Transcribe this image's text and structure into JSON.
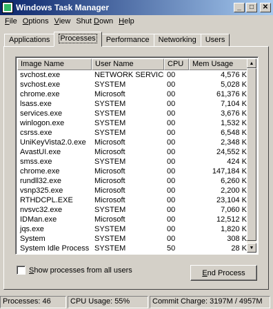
{
  "window": {
    "title": "Windows Task Manager"
  },
  "menu": [
    {
      "underline": "F",
      "rest": "ile"
    },
    {
      "underline": "O",
      "rest": "ptions"
    },
    {
      "underline": "V",
      "rest": "iew"
    },
    {
      "pre": "Shut ",
      "underline": "D",
      "rest": "own"
    },
    {
      "underline": "H",
      "rest": "elp"
    }
  ],
  "tabs": [
    "Applications",
    "Processes",
    "Performance",
    "Networking",
    "Users"
  ],
  "active_tab": "Processes",
  "columns": [
    "Image Name",
    "User Name",
    "CPU",
    "Mem Usage"
  ],
  "processes": [
    [
      "svchost.exe",
      "NETWORK SERVICE",
      "00",
      "4,576 K"
    ],
    [
      "svchost.exe",
      "SYSTEM",
      "00",
      "5,028 K"
    ],
    [
      "chrome.exe",
      "Microsoft",
      "00",
      "61,376 K"
    ],
    [
      "lsass.exe",
      "SYSTEM",
      "00",
      "7,104 K"
    ],
    [
      "services.exe",
      "SYSTEM",
      "00",
      "3,676 K"
    ],
    [
      "winlogon.exe",
      "SYSTEM",
      "00",
      "1,532 K"
    ],
    [
      "csrss.exe",
      "SYSTEM",
      "00",
      "6,548 K"
    ],
    [
      "UniKeyVista2.0.exe",
      "Microsoft",
      "00",
      "2,348 K"
    ],
    [
      "AvastUI.exe",
      "Microsoft",
      "00",
      "24,552 K"
    ],
    [
      "smss.exe",
      "SYSTEM",
      "00",
      "424 K"
    ],
    [
      "chrome.exe",
      "Microsoft",
      "00",
      "147,184 K"
    ],
    [
      "rundll32.exe",
      "Microsoft",
      "00",
      "6,260 K"
    ],
    [
      "vsnp325.exe",
      "Microsoft",
      "00",
      "2,200 K"
    ],
    [
      "RTHDCPL.EXE",
      "Microsoft",
      "00",
      "23,104 K"
    ],
    [
      "nvsvc32.exe",
      "SYSTEM",
      "00",
      "7,060 K"
    ],
    [
      "IDMan.exe",
      "Microsoft",
      "00",
      "12,512 K"
    ],
    [
      "jqs.exe",
      "SYSTEM",
      "00",
      "1,820 K"
    ],
    [
      "System",
      "SYSTEM",
      "00",
      "308 K"
    ],
    [
      "System Idle Process",
      "SYSTEM",
      "50",
      "28 K"
    ]
  ],
  "show_all": {
    "underline": "S",
    "rest": "how processes from all users",
    "checked": false
  },
  "end_process": {
    "underline": "E",
    "rest": "nd Process"
  },
  "status": {
    "processes": "Processes: 46",
    "cpu": "CPU Usage: 55%",
    "commit": "Commit Charge: 3197M / 4957M"
  }
}
